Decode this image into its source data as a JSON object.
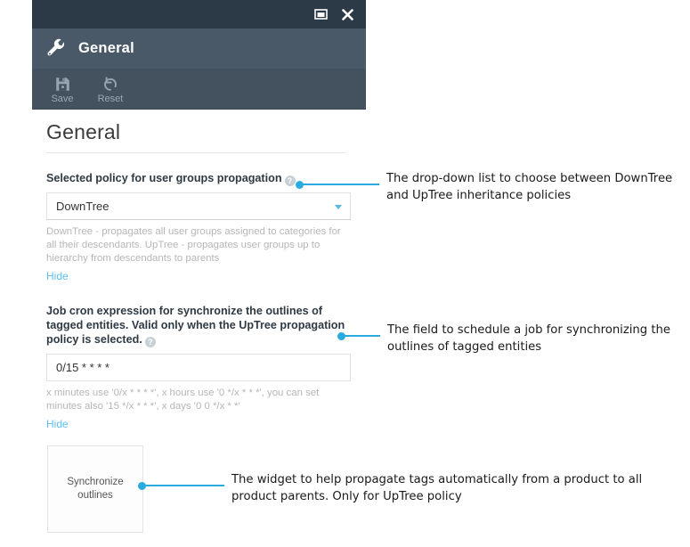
{
  "window": {
    "titlebar": {
      "restore_icon": "restore-window-icon",
      "close_icon": "close-icon"
    },
    "header": {
      "icon": "wrench-icon",
      "title": "General"
    },
    "toolbar": {
      "items": [
        {
          "icon": "save-floppy-icon",
          "label": "Save"
        },
        {
          "icon": "reset-undo-icon",
          "label": "Reset"
        }
      ]
    }
  },
  "page": {
    "title": "General",
    "fields": [
      {
        "label": "Selected policy for user groups propagation",
        "help_icon": "question-mark-icon",
        "type": "select",
        "value": "DownTree",
        "caret_icon": "chevron-down-icon",
        "hint": "DownTree - propagates all user groups assigned to categories for all their descendants. UpTree - propagates user groups up to hierarchy from descendants to parents",
        "hide_label": "Hide"
      },
      {
        "label": "Job cron expression for synchronize the outlines of tagged entities. Valid only when the UpTree propagation policy is selected.",
        "help_icon": "question-mark-icon",
        "type": "text",
        "value": "0/15 * * * *",
        "hint": "x minutes use '0/x * * * *', x hours use '0 */x * * *',  you can set minutes also '15 */x * * *', x days '0 0 */x * *'",
        "hide_label": "Hide"
      }
    ],
    "widget": {
      "label": "Synchronize outlines"
    }
  },
  "annotations": [
    {
      "text_line1": "The drop-down list to  choose between DownTree",
      "text_line2": "and UpTree inheritance policies"
    },
    {
      "text_line1": "The field to schedule a job for synchronizing the",
      "text_line2": "outlines of tagged entities"
    },
    {
      "text_line1": "The widget to help propagate tags automatically from a product to all",
      "text_line2": "product parents. Only for UpTree policy"
    }
  ],
  "colors": {
    "titlebar": "#2c3947",
    "header": "#4a5968",
    "toolbar": "#44525f",
    "accent_blue": "#29abe2",
    "link_blue": "#5bc0f0"
  }
}
